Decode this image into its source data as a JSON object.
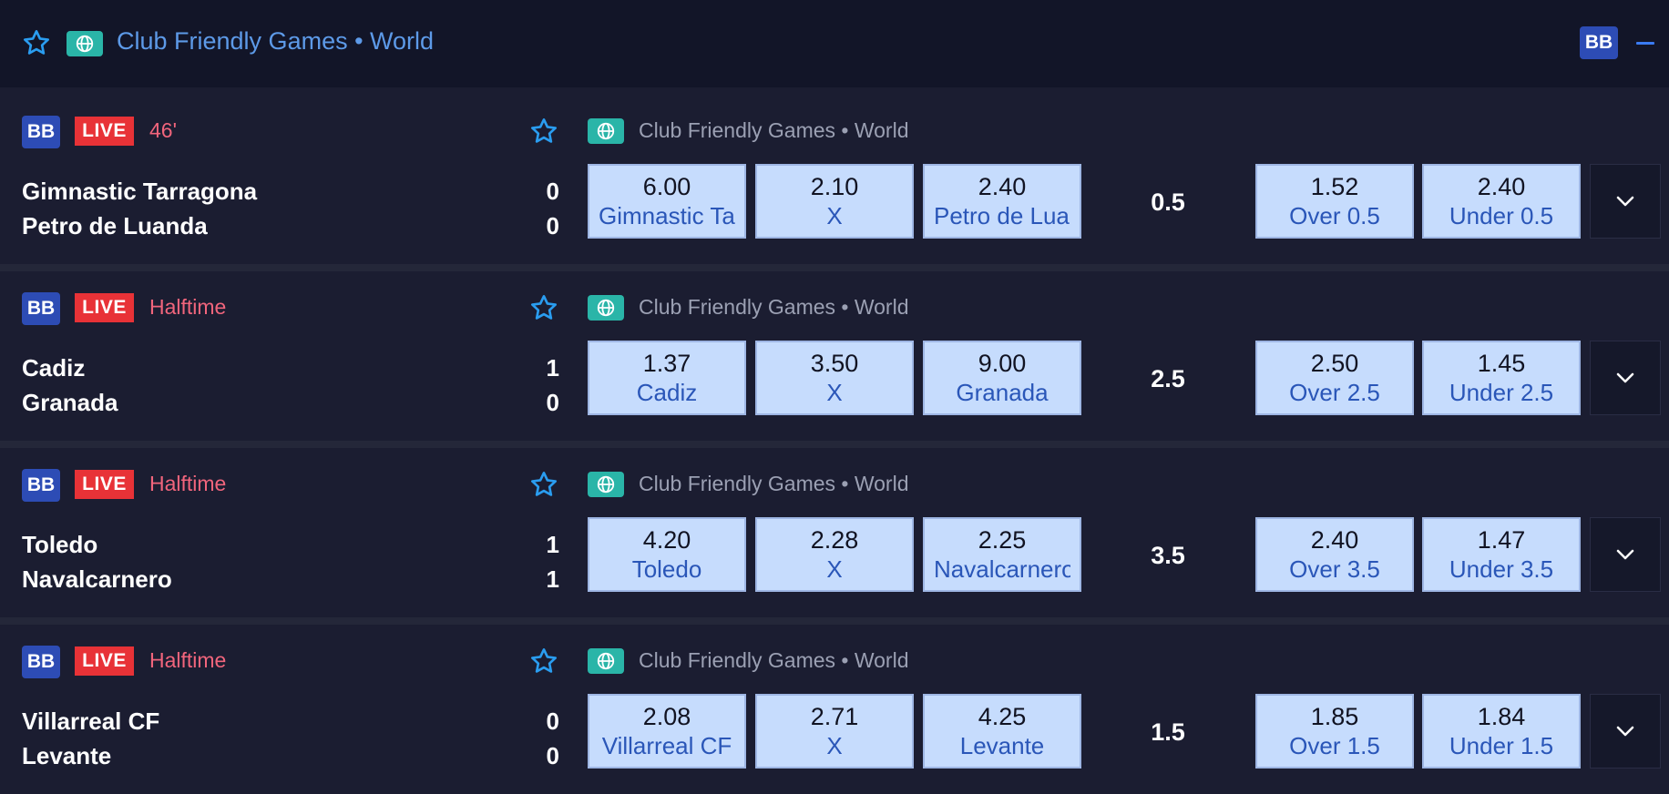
{
  "header": {
    "title": "Club Friendly Games • World",
    "bb_badge": "BB",
    "favorite_icon": "star-outline-icon",
    "globe_icon": "globe-icon",
    "collapse_icon": "minus-icon"
  },
  "colors": {
    "accent_blue": "#3a7bf2",
    "live_red": "#e83237",
    "status_pink": "#f1657c",
    "odd_bg": "#c6dcfd",
    "globe_teal": "#2ab5a8"
  },
  "events": [
    {
      "bb": "BB",
      "live": "LIVE",
      "status": "46'",
      "league": "Club Friendly Games • World",
      "home": "Gimnastic Tarragona",
      "away": "Petro de Luanda",
      "home_score": "0",
      "away_score": "0",
      "odds": {
        "home": {
          "value": "6.00",
          "label": "Gimnastic Tarragona"
        },
        "draw": {
          "value": "2.10",
          "label": "X"
        },
        "away": {
          "value": "2.40",
          "label": "Petro de Luanda"
        }
      },
      "total_line": "0.5",
      "over": {
        "value": "1.52",
        "label": "Over 0.5"
      },
      "under": {
        "value": "2.40",
        "label": "Under 0.5"
      }
    },
    {
      "bb": "BB",
      "live": "LIVE",
      "status": "Halftime",
      "league": "Club Friendly Games • World",
      "home": "Cadiz",
      "away": "Granada",
      "home_score": "1",
      "away_score": "0",
      "odds": {
        "home": {
          "value": "1.37",
          "label": "Cadiz"
        },
        "draw": {
          "value": "3.50",
          "label": "X"
        },
        "away": {
          "value": "9.00",
          "label": "Granada"
        }
      },
      "total_line": "2.5",
      "over": {
        "value": "2.50",
        "label": "Over 2.5"
      },
      "under": {
        "value": "1.45",
        "label": "Under 2.5"
      }
    },
    {
      "bb": "BB",
      "live": "LIVE",
      "status": "Halftime",
      "league": "Club Friendly Games • World",
      "home": "Toledo",
      "away": "Navalcarnero",
      "home_score": "1",
      "away_score": "1",
      "odds": {
        "home": {
          "value": "4.20",
          "label": "Toledo"
        },
        "draw": {
          "value": "2.28",
          "label": "X"
        },
        "away": {
          "value": "2.25",
          "label": "Navalcarnero"
        }
      },
      "total_line": "3.5",
      "over": {
        "value": "2.40",
        "label": "Over 3.5"
      },
      "under": {
        "value": "1.47",
        "label": "Under 3.5"
      }
    },
    {
      "bb": "BB",
      "live": "LIVE",
      "status": "Halftime",
      "league": "Club Friendly Games • World",
      "home": "Villarreal CF",
      "away": "Levante",
      "home_score": "0",
      "away_score": "0",
      "odds": {
        "home": {
          "value": "2.08",
          "label": "Villarreal CF"
        },
        "draw": {
          "value": "2.71",
          "label": "X"
        },
        "away": {
          "value": "4.25",
          "label": "Levante"
        }
      },
      "total_line": "1.5",
      "over": {
        "value": "1.85",
        "label": "Over 1.5"
      },
      "under": {
        "value": "1.84",
        "label": "Under 1.5"
      }
    }
  ]
}
